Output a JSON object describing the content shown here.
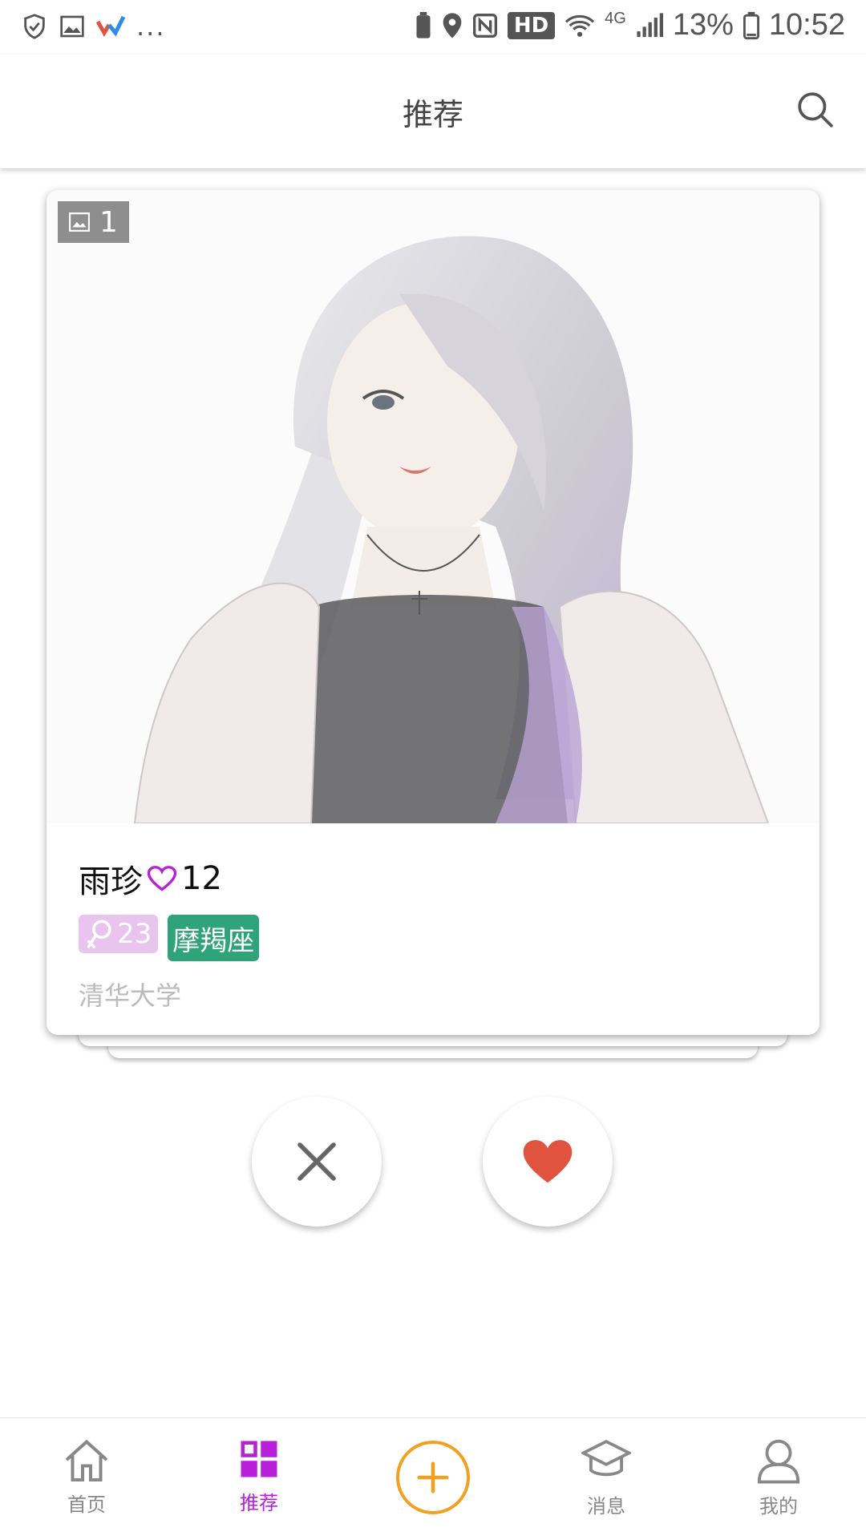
{
  "status_bar": {
    "left_icons": [
      "shield-check-icon",
      "image-icon",
      "app-logo-icon"
    ],
    "more": "...",
    "right_icons": [
      "battery-saver-icon",
      "location-icon",
      "nfc-icon"
    ],
    "hd": "HD",
    "network": "4G",
    "battery": "13%",
    "time": "10:52"
  },
  "header": {
    "title": "推荐",
    "search_icon": "search-icon"
  },
  "card": {
    "photo_count": "1",
    "name": "雨珍",
    "likes": "12",
    "age": "23",
    "zodiac": "摩羯座",
    "school": "清华大学",
    "colors": {
      "heart": "#b81fd8",
      "gender_tag": "#e9c4ef",
      "zodiac_tag": "#2fa37a"
    }
  },
  "actions": {
    "dislike_icon": "close-icon",
    "like_icon": "heart-icon",
    "like_color": "#e0533f"
  },
  "bottom_nav": {
    "items": [
      {
        "label": "首页",
        "icon": "home-icon"
      },
      {
        "label": "推荐",
        "icon": "grid-icon",
        "active": true
      },
      {
        "label": "",
        "icon": "add-icon"
      },
      {
        "label": "消息",
        "icon": "graduation-cap-icon"
      },
      {
        "label": "我的",
        "icon": "user-icon"
      }
    ],
    "active_color": "#b81fd8",
    "add_color": "#f2a01f"
  }
}
